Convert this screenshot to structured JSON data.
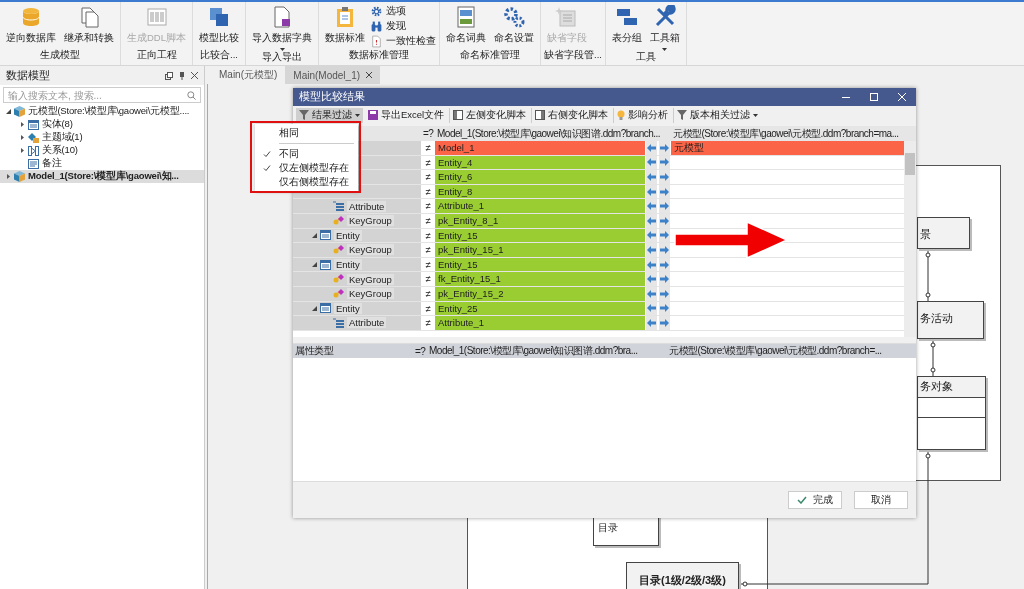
{
  "ribbon": {
    "groups": [
      {
        "label": "生成模型",
        "items": [
          {
            "kind": "large",
            "label": "逆向数据库",
            "disabled": false,
            "dropdown": false
          },
          {
            "kind": "large",
            "label": "继承和转换",
            "disabled": false,
            "dropdown": false
          }
        ]
      },
      {
        "label": "正向工程",
        "items": [
          {
            "kind": "large",
            "label": "生成DDL脚本",
            "disabled": true,
            "dropdown": false
          }
        ]
      },
      {
        "label": "比较合...",
        "items": [
          {
            "kind": "large",
            "label": "模型比较",
            "disabled": false,
            "dropdown": false
          }
        ]
      },
      {
        "label": "导入导出",
        "items": [
          {
            "kind": "large",
            "label": "导入数据字典",
            "disabled": false,
            "dropdown": true
          }
        ]
      },
      {
        "label": "数据标准管理",
        "items": [
          {
            "kind": "large",
            "label": "数据标准",
            "disabled": false,
            "dropdown": false
          },
          {
            "kind": "small",
            "label": "选项",
            "disabled": false
          },
          {
            "kind": "small",
            "label": "发现",
            "disabled": false
          },
          {
            "kind": "small",
            "label": "一致性检查",
            "disabled": false
          }
        ]
      },
      {
        "label": "命名标准管理",
        "items": [
          {
            "kind": "large",
            "label": "命名词典",
            "disabled": false,
            "dropdown": false
          },
          {
            "kind": "large",
            "label": "命名设置",
            "disabled": false,
            "dropdown": false
          }
        ]
      },
      {
        "label": "缺省字段管...",
        "items": [
          {
            "kind": "large",
            "label": "缺省字段",
            "disabled": true,
            "dropdown": false
          }
        ]
      },
      {
        "label": "工具",
        "items": [
          {
            "kind": "large",
            "label": "表分组",
            "disabled": false,
            "dropdown": false
          },
          {
            "kind": "large",
            "label": "工具箱",
            "disabled": false,
            "dropdown": true
          }
        ]
      }
    ]
  },
  "sidebar": {
    "title": "数据模型",
    "search": {
      "placeholder": "输入搜索文本, 搜索..."
    },
    "tree": [
      {
        "label": "元模型(Store:\\模型库\\gaowei\\元模型....",
        "kind": "model",
        "bold": false,
        "selected": false,
        "expanded": true,
        "children": [
          {
            "label": "实体(8)",
            "kind": "entities",
            "expanded": false,
            "selected": false
          },
          {
            "label": "主题域(1)",
            "kind": "subjects",
            "expanded": false,
            "selected": false
          },
          {
            "label": "关系(10)",
            "kind": "relations",
            "expanded": false,
            "selected": false
          },
          {
            "label": "备注",
            "kind": "notes",
            "selected": false
          }
        ]
      },
      {
        "label": "Model_1(Store:\\模型库\\gaowei\\知...",
        "kind": "model",
        "bold": true,
        "selected": true,
        "expanded": false
      }
    ]
  },
  "tabs": [
    {
      "label": "Main(元模型)",
      "selected": false,
      "closable": false
    },
    {
      "label": "Main(Model_1)",
      "selected": true,
      "closable": true
    }
  ],
  "diagram": {
    "entities": [
      {
        "name": "景",
        "kind": "plain"
      },
      {
        "name": "务活动",
        "kind": "plain"
      },
      {
        "name": "务对象",
        "kind": "table"
      },
      {
        "name": "目录(1级/2级/3级)",
        "kind": "plain"
      }
    ],
    "notes": [
      {
        "text": "目录"
      }
    ]
  },
  "dialog": {
    "title": "模型比较结果",
    "toolbar": [
      {
        "label": "结果过滤",
        "dropdown": true,
        "pressed": true
      },
      {
        "label": "导出Excel文件",
        "dropdown": false,
        "pressed": false
      },
      {
        "label": "左侧变化脚本",
        "dropdown": false,
        "pressed": false
      },
      {
        "label": "右侧变化脚本",
        "dropdown": false,
        "pressed": false
      },
      {
        "label": "影响分析",
        "dropdown": false,
        "pressed": false
      },
      {
        "label": "版本相关过滤",
        "dropdown": true,
        "pressed": false
      }
    ],
    "filter_menu": [
      {
        "kind": "option",
        "label": "相同",
        "checked": false
      },
      {
        "kind": "separator"
      },
      {
        "kind": "option",
        "label": "不同",
        "checked": true
      },
      {
        "kind": "option",
        "label": "仅左侧模型存在",
        "checked": true
      },
      {
        "kind": "option",
        "label": "仅右侧模型存在",
        "checked": false
      }
    ],
    "grid": {
      "columns": [
        "=?",
        "Model_1(Store:\\模型库\\gaowei\\知识图谱.ddm?branch...",
        "元模型(Store:\\模型库\\gaowei\\元模型.ddm?branch=ma..."
      ],
      "rows": [
        {
          "diff": "≠",
          "left": "Model_1",
          "right": "元模型",
          "left_only": false,
          "children": [
            {
              "diff": "≠",
              "left": "Entity_4",
              "left_only": true
            },
            {
              "diff": "≠",
              "left": "Entity_6",
              "left_only": true
            },
            {
              "diff": "≠",
              "left": "Entity_8",
              "left_only": true,
              "children": [
                {
                  "node": "Attribute",
                  "kind": "attribute",
                  "diff": "≠",
                  "left": "Attribute_1",
                  "left_only": true
                },
                {
                  "node": "KeyGroup",
                  "kind": "keygroup",
                  "diff": "≠",
                  "left": "pk_Entity_8_1",
                  "left_only": true
                }
              ]
            },
            {
              "node": "Entity",
              "kind": "entity",
              "expanded": true,
              "diff": "≠",
              "left": "Entity_15",
              "left_only": true,
              "children": [
                {
                  "node": "KeyGroup",
                  "kind": "keygroup",
                  "diff": "≠",
                  "left": "pk_Entity_15_1",
                  "left_only": true
                }
              ]
            },
            {
              "node": "Entity",
              "kind": "entity",
              "expanded": true,
              "diff": "≠",
              "left": "Entity_15",
              "left_only": true,
              "children": [
                {
                  "node": "KeyGroup",
                  "kind": "keygroup",
                  "diff": "≠",
                  "left": "fk_Entity_15_1",
                  "left_only": true
                },
                {
                  "node": "KeyGroup",
                  "kind": "keygroup",
                  "diff": "≠",
                  "left": "pk_Entity_15_2",
                  "left_only": true
                }
              ]
            },
            {
              "node": "Entity",
              "kind": "entity",
              "expanded": true,
              "diff": "≠",
              "left": "Entity_25",
              "left_only": true,
              "children": [
                {
                  "node": "Attribute",
                  "kind": "attribute",
                  "diff": "≠",
                  "left": "Attribute_1",
                  "left_only": true
                }
              ]
            }
          ]
        }
      ]
    },
    "detail_columns": [
      "属性类型",
      "=?",
      "Model_1(Store:\\模型库\\gaowei\\知识图谱.ddm?bra...",
      "元模型(Store:\\模型库\\gaowei\\元模型.ddm?branch=..."
    ],
    "buttons": [
      {
        "label": "完成",
        "kind": "confirm"
      },
      {
        "label": "取消",
        "kind": "cancel"
      }
    ]
  }
}
